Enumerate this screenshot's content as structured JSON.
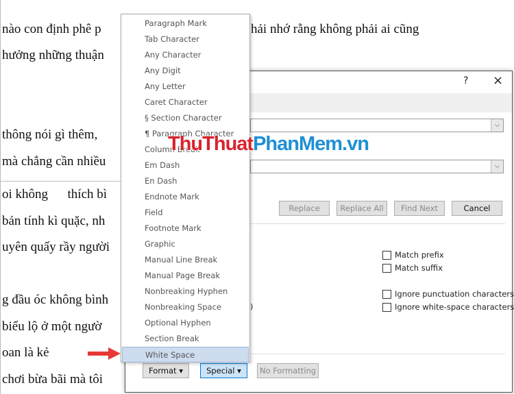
{
  "document": {
    "lines": [
      "nào con định phê p",
      "hưởng những thuận",
      "thông nói gì thêm,",
      "mà chẳng cần nhiều",
      "oi không      thích bì",
      "bản tính kì quặc, nh",
      "uyên quấy rầy người",
      "g đầu óc không bình",
      "biểu lộ ở một ngườ",
      "oan là kẻ",
      "chơi bừa bãi mà tôi"
    ],
    "line2": "hải nhớ rằng không phải ai cũng"
  },
  "dialog": {
    "help": "?",
    "close": "×",
    "buttons": {
      "replace": "Replace",
      "replace_all": "Replace All",
      "find_next": "Find Next",
      "cancel": "Cancel",
      "format": "Format ▾",
      "special": "Special ▾",
      "no_formatting": "No Formatting"
    },
    "checkboxes": [
      {
        "label": "Match prefix",
        "checked": false
      },
      {
        "label": "Match suffix",
        "checked": false
      },
      {
        "label": "Ignore punctuation characters",
        "checked": false
      },
      {
        "label": "Ignore white-space characters",
        "checked": false
      }
    ],
    "partial_text": ")"
  },
  "special_menu": {
    "items": [
      "Paragraph Mark",
      "Tab Character",
      "Any Character",
      "Any Digit",
      "Any Letter",
      "Caret Character",
      "§ Section Character",
      "¶ Paragraph Character",
      "Column Break",
      "Em Dash",
      "En Dash",
      "Endnote Mark",
      "Field",
      "Footnote Mark",
      "Graphic",
      "Manual Line Break",
      "Manual Page Break",
      "Nonbreaking Hyphen",
      "Nonbreaking Space",
      "Optional Hyphen",
      "Section Break",
      "White Space"
    ],
    "selected": "White Space"
  },
  "watermark": {
    "part1": "ThuThuat",
    "part2": "PhanMem.vn"
  },
  "colors": {
    "arrow": "#e53935",
    "highlight": "#cddcee"
  }
}
